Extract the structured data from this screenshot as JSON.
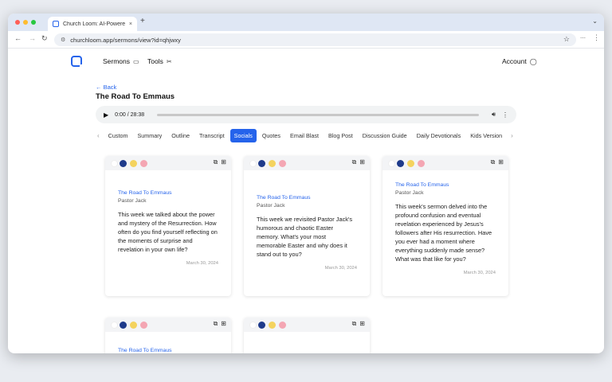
{
  "browser": {
    "tab_title": "Church Loom: AI-Powered C",
    "tab_close": "×",
    "new_tab": "+",
    "url": "churchloom.app/sermons/view?id=qhjwxy"
  },
  "site": {
    "nav": [
      {
        "label": "Sermons",
        "icon": "monitor-icon"
      },
      {
        "label": "Tools",
        "icon": "wand-icon"
      }
    ],
    "account_label": "Account"
  },
  "sermon": {
    "back_label": "← Back",
    "title": "The Road To Emmaus",
    "player_time": "0:00 / 28:38"
  },
  "content_tabs": [
    "Custom",
    "Summary",
    "Outline",
    "Transcript",
    "Socials",
    "Quotes",
    "Email Blast",
    "Blog Post",
    "Discussion Guide",
    "Daily Devotionals",
    "Kids Version"
  ],
  "active_tab": "Socials",
  "cards": [
    {
      "title": "The Road To Emmaus",
      "author": "Pastor Jack",
      "text": "This week we talked about the power and mystery of the Resurrection. How often do you find yourself reflecting on the moments of surprise and revelation in your own life?",
      "date": "March 30, 2024"
    },
    {
      "title": "The Road To Emmaus",
      "author": "Pastor Jack",
      "text": "This week we revisited Pastor Jack's humorous and chaotic Easter memory. What's your most memorable Easter and why does it stand out to you?",
      "date": "March 30, 2024"
    },
    {
      "title": "The Road To Emmaus",
      "author": "Pastor Jack",
      "text": "This week's sermon delved into the profound confusion and eventual revelation experienced by Jesus's followers after His resurrection. Have you ever had a moment where everything suddenly made sense? What was that like for you?",
      "date": "March 30, 2024"
    },
    {
      "title": "The Road To Emmaus",
      "author": "",
      "text": "",
      "date": ""
    },
    {
      "title": "",
      "author": "",
      "text": "",
      "date": ""
    }
  ],
  "colors": {
    "accent": "#2563eb",
    "swatch_blue": "#1e3a8a",
    "swatch_yellow": "#f4d35e",
    "swatch_pink": "#f4a6b3"
  }
}
